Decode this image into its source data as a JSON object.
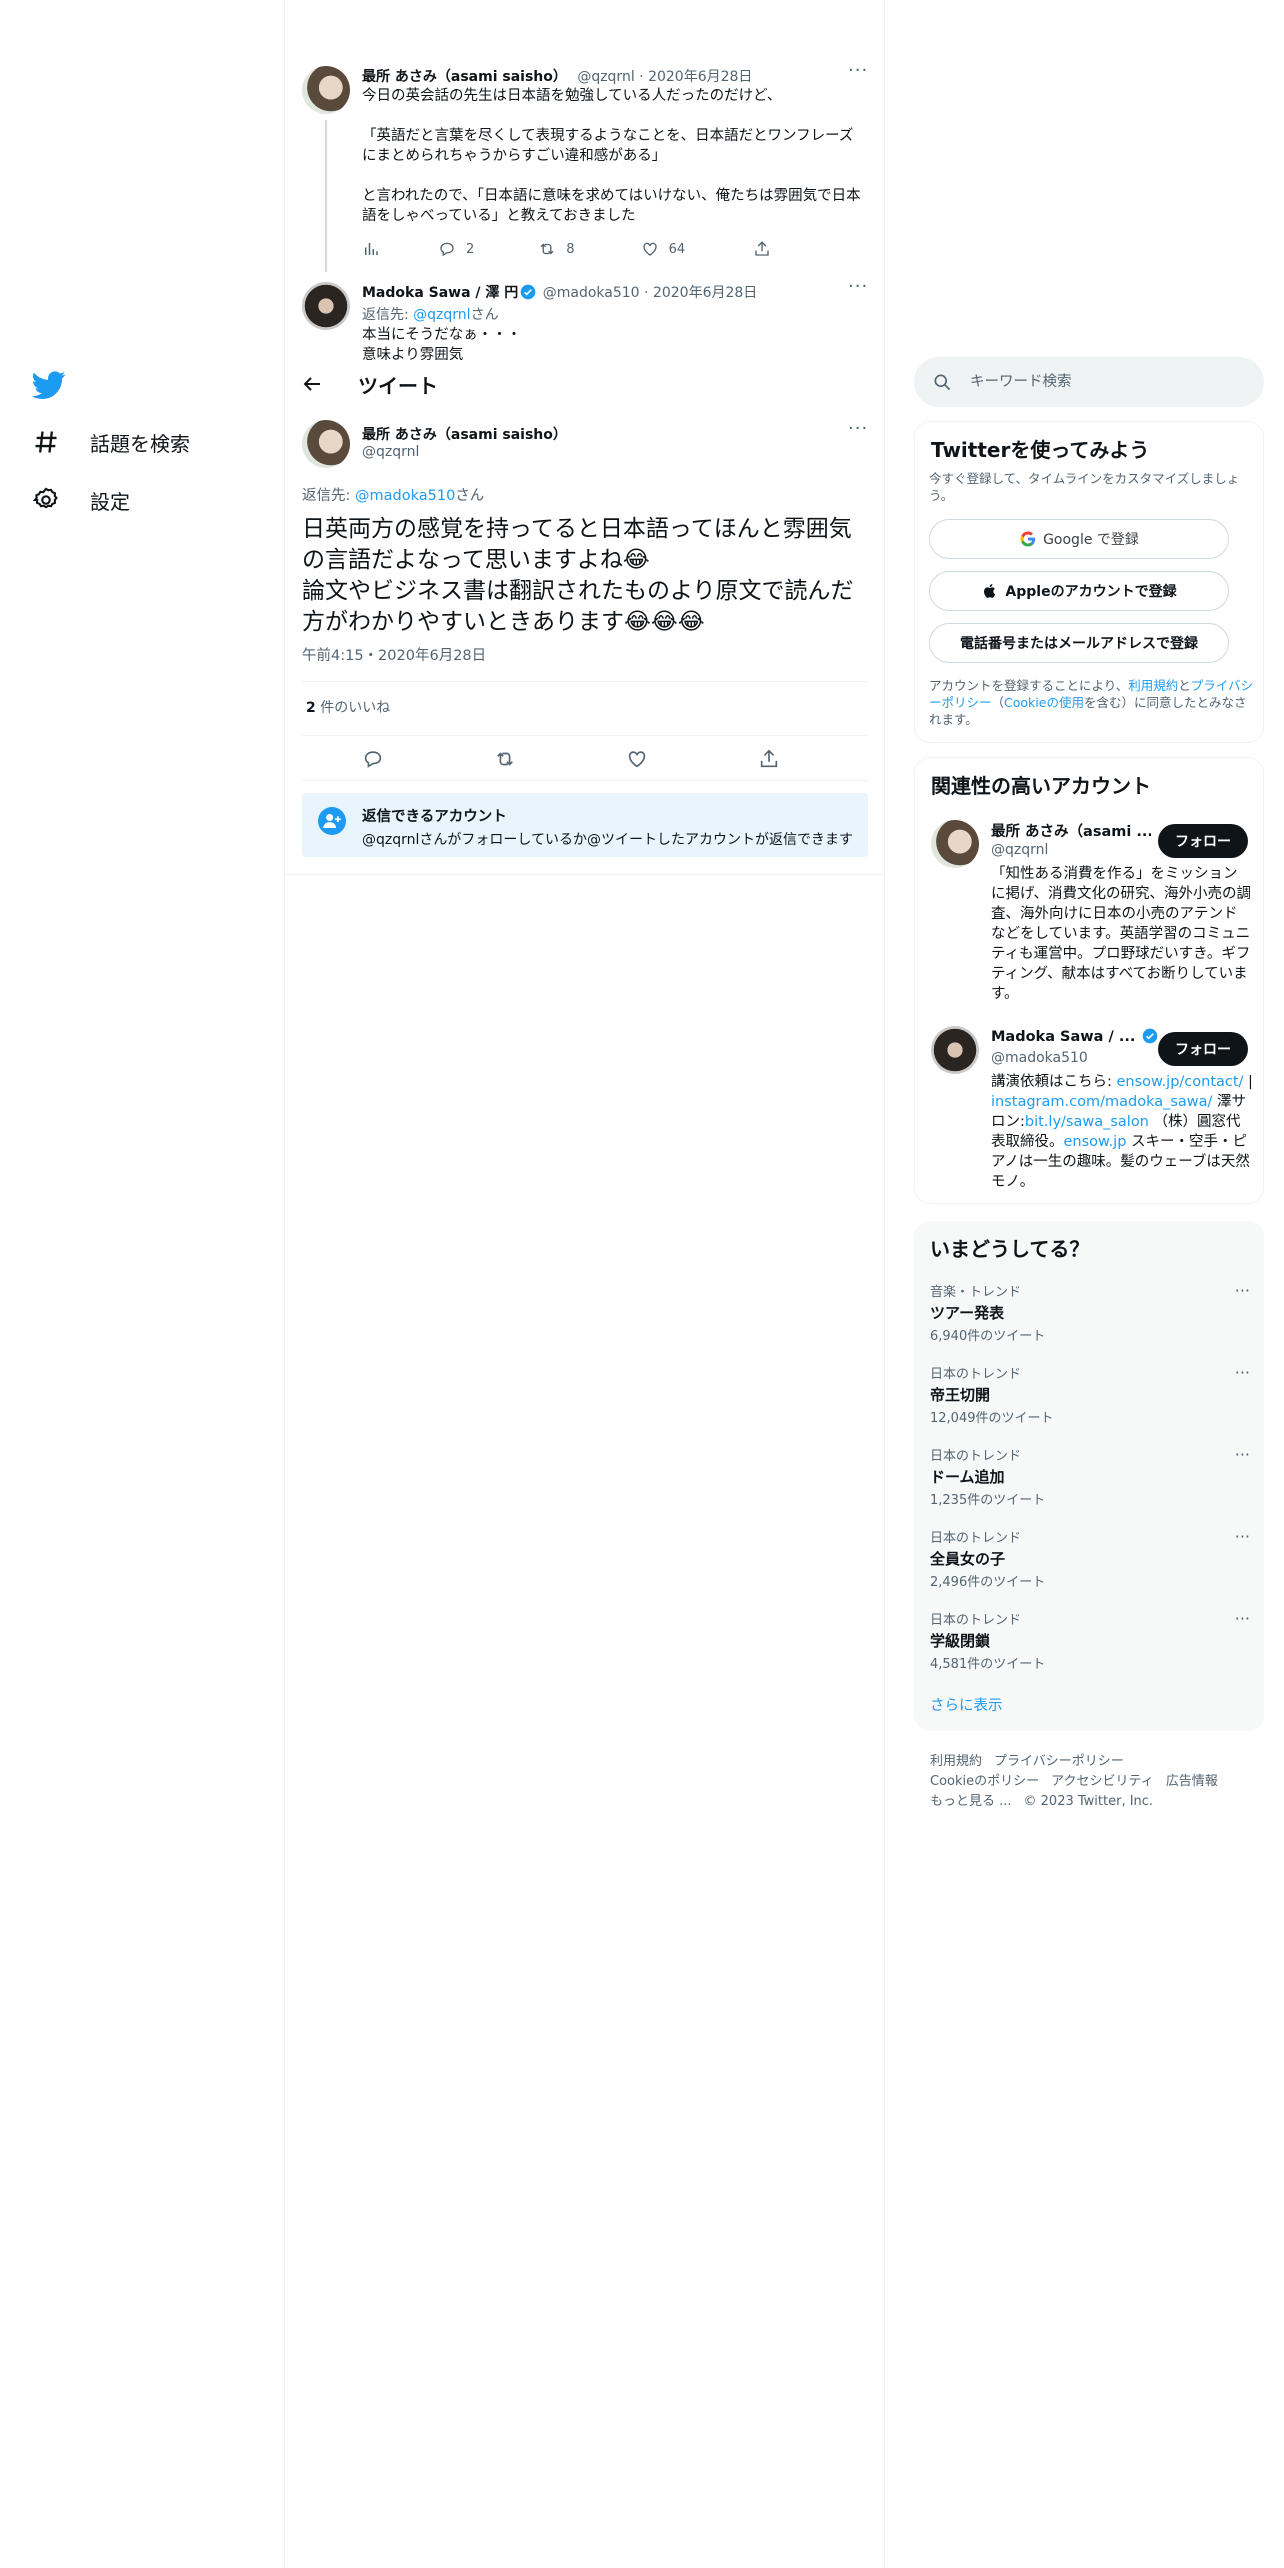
{
  "nav": {
    "items": [
      {
        "label": "話題を検索"
      },
      {
        "label": "設定"
      }
    ]
  },
  "thread": {
    "tweet1": {
      "name": "最所 あさみ（asami saisho）",
      "handle": "@qzqrnl",
      "date": "2020年6月28日",
      "text": "今日の英会話の先生は日本語を勉強している人だったのだけど、\n\n「英語だと言葉を尽くして表現するようなことを、日本語だとワンフレーズにまとめられちゃうからすごい違和感がある」\n\nと言われたので、「日本語に意味を求めてはいけない、俺たちは雰囲気で日本語をしゃべっている」と教えておきました",
      "replies": "2",
      "retweets": "8",
      "likes": "64"
    },
    "tweet2": {
      "name": "Madoka Sawa / 澤 円",
      "handle": "@madoka510",
      "date": "2020年6月28日",
      "reply_prefix": "返信先: ",
      "reply_handle": "@qzqrnl",
      "reply_suffix": "さん",
      "text_line1": "本当にそうだなぁ・・・",
      "text_line2": "意味より雰囲気"
    }
  },
  "topbar": {
    "title": "ツイート"
  },
  "focus": {
    "name": "最所 あさみ（asami saisho）",
    "handle": "@qzqrnl",
    "reply_prefix": "返信先: ",
    "reply_handle": "@madoka510",
    "reply_suffix": "さん",
    "text": "日英両方の感覚を持ってると日本語ってほんと雰囲気の言語だよなって思いますよね😂\n論文やビジネス書は翻訳されたものより原文で読んだ方がわかりやすいときあります😂😂😂",
    "timestamp": "午前4:15・2020年6月28日",
    "likes_count": "2",
    "likes_label": "件のいいね",
    "notice_title": "返信できるアカウント",
    "notice_text": "@qzqrnlさんがフォローしているか@ツイートしたアカウントが返信できます"
  },
  "search": {
    "placeholder": "キーワード検索"
  },
  "signup": {
    "title": "Twitterを使ってみよう",
    "subtitle": "今すぐ登録して、タイムラインをカスタマイズしましょう。",
    "google": "Google で登録",
    "apple": "Appleのアカウントで登録",
    "phone": "電話番号またはメールアドレスで登録",
    "terms_1": "アカウントを登録することにより、",
    "terms_link1": "利用規約",
    "terms_2": "と",
    "terms_link2": "プライバシーポリシー",
    "terms_3": "（",
    "terms_link3": "Cookieの使用",
    "terms_4": "を含む）に同意したとみなされます。"
  },
  "related": {
    "title": "関連性の高いアカウント",
    "accounts": [
      {
        "name": "最所 あさみ（asami ...",
        "handle": "@qzqrnl",
        "follow": "フォロー",
        "bio": "「知性ある消費を作る」をミッションに掲げ、消費文化の研究、海外小売の調査、海外向けに日本の小売のアテンドなどをしています。英語学習のコミュニティも運営中。プロ野球だいすき。ギフティング、献本はすべてお断りしています。"
      },
      {
        "name": "Madoka Sawa / ...",
        "handle": "@madoka510",
        "follow": "フォロー",
        "bio_1": "講演依頼はこちら: ",
        "bio_link1": "ensow.jp/contact/",
        "bio_2": " | ",
        "bio_link2": "instagram.com/madoka_sawa/",
        "bio_3": " 澤サロン:",
        "bio_link3": "bit.ly/sawa_salon",
        "bio_4": " （株）圓窓代表取締役。",
        "bio_link4": "ensow.jp",
        "bio_5": " スキー・空手・ピアノは一生の趣味。髪のウェーブは天然モノ。"
      }
    ]
  },
  "trends": {
    "title": "いまどうしてる？",
    "items": [
      {
        "category": "音楽・トレンド",
        "name": "ツアー発表",
        "count": "6,940件のツイート"
      },
      {
        "category": "日本のトレンド",
        "name": "帝王切開",
        "count": "12,049件のツイート"
      },
      {
        "category": "日本のトレンド",
        "name": "ドーム追加",
        "count": "1,235件のツイート"
      },
      {
        "category": "日本のトレンド",
        "name": "全員女の子",
        "count": "2,496件のツイート"
      },
      {
        "category": "日本のトレンド",
        "name": "学級閉鎖",
        "count": "4,581件のツイート"
      }
    ],
    "show_more": "さらに表示"
  },
  "footer": {
    "row1": [
      "利用規約",
      "プライバシーポリシー"
    ],
    "row2": [
      "Cookieのポリシー",
      "アクセシビリティ",
      "広告情報"
    ],
    "row3": [
      "もっと見る ...",
      "© 2023 Twitter, Inc."
    ]
  },
  "colors": {
    "accent": "#1d9bf0",
    "text": "#0f1419",
    "muted": "#536471"
  }
}
